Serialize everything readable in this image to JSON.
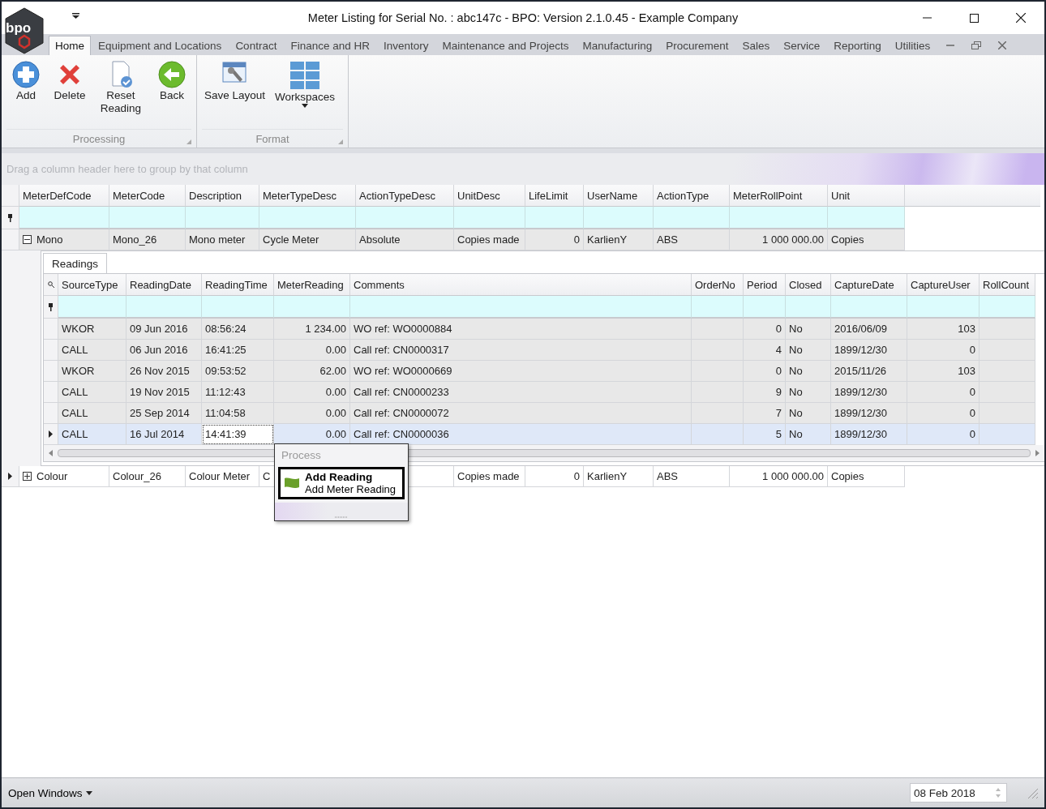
{
  "window": {
    "logo": "bpo",
    "title": "Meter Listing for Serial No. : abc147c - BPO: Version 2.1.0.45 - Example Company"
  },
  "ribbon_tabs": [
    {
      "label": "Home",
      "selected": true
    },
    {
      "label": "Equipment and Locations",
      "selected": false
    },
    {
      "label": "Contract",
      "selected": false
    },
    {
      "label": "Finance and HR",
      "selected": false
    },
    {
      "label": "Inventory",
      "selected": false
    },
    {
      "label": "Maintenance and Projects",
      "selected": false
    },
    {
      "label": "Manufacturing",
      "selected": false
    },
    {
      "label": "Procurement",
      "selected": false
    },
    {
      "label": "Sales",
      "selected": false
    },
    {
      "label": "Service",
      "selected": false
    },
    {
      "label": "Reporting",
      "selected": false
    },
    {
      "label": "Utilities",
      "selected": false
    }
  ],
  "ribbon_groups": [
    {
      "title": "Processing",
      "buttons": [
        {
          "label": "Add"
        },
        {
          "label": "Delete"
        },
        {
          "label": "Reset Reading"
        },
        {
          "label": "Back"
        }
      ]
    },
    {
      "title": "Format",
      "buttons": [
        {
          "label": "Save Layout"
        },
        {
          "label": "Workspaces",
          "dropdown": true
        }
      ]
    }
  ],
  "group_panel": {
    "hint": "Drag a column header here to group by that column"
  },
  "master_grid": {
    "columns": [
      {
        "label": "MeterDefCode"
      },
      {
        "label": "MeterCode"
      },
      {
        "label": "Description"
      },
      {
        "label": "MeterTypeDesc"
      },
      {
        "label": "ActionTypeDesc"
      },
      {
        "label": "UnitDesc"
      },
      {
        "label": "LifeLimit"
      },
      {
        "label": "UserName"
      },
      {
        "label": "ActionType"
      },
      {
        "label": "MeterRollPoint"
      },
      {
        "label": "Unit"
      }
    ],
    "rows": [
      {
        "expanded": true,
        "current": false,
        "cells": [
          "Mono",
          "Mono_26",
          "Mono meter",
          "Cycle Meter",
          "Absolute",
          "Copies made",
          "0",
          "KarlienY",
          "ABS",
          "1 000 000.00",
          "Copies"
        ]
      },
      {
        "expanded": false,
        "current": true,
        "cells": [
          "Colour",
          "Colour_26",
          "Colour Meter",
          "C",
          null,
          "Copies made",
          "0",
          "KarlienY",
          "ABS",
          "1 000 000.00",
          "Copies"
        ]
      }
    ]
  },
  "detail_tab": "Readings",
  "detail_grid": {
    "columns": [
      {
        "label": "SourceType",
        "kind": "text"
      },
      {
        "label": "ReadingDate",
        "kind": "text"
      },
      {
        "label": "ReadingTime",
        "kind": "text"
      },
      {
        "label": "MeterReading",
        "kind": "number"
      },
      {
        "label": "Comments",
        "kind": "text"
      },
      {
        "label": "OrderNo",
        "kind": "text"
      },
      {
        "label": "Period",
        "kind": "number"
      },
      {
        "label": "Closed",
        "kind": "text"
      },
      {
        "label": "CaptureDate",
        "kind": "text"
      },
      {
        "label": "CaptureUser",
        "kind": "number"
      },
      {
        "label": "RollCount",
        "kind": "text"
      }
    ],
    "rows": [
      {
        "selected": false,
        "cells": [
          "WKOR",
          "09 Jun 2016",
          "08:56:24",
          "1 234.00",
          "WO ref: WO0000884",
          null,
          "0",
          "No",
          "2016/06/09",
          "103",
          null
        ]
      },
      {
        "selected": false,
        "cells": [
          "CALL",
          "06 Jun 2016",
          "16:41:25",
          "0.00",
          "Call ref: CN0000317",
          null,
          "4",
          "No",
          "1899/12/30",
          "0",
          null
        ]
      },
      {
        "selected": false,
        "cells": [
          "WKOR",
          "26 Nov 2015",
          "09:53:52",
          "62.00",
          "WO ref: WO0000669",
          null,
          "0",
          "No",
          "2015/11/26",
          "103",
          null
        ]
      },
      {
        "selected": false,
        "cells": [
          "CALL",
          "19 Nov 2015",
          "11:12:43",
          "0.00",
          "Call ref: CN0000233",
          null,
          "9",
          "No",
          "1899/12/30",
          "0",
          null
        ]
      },
      {
        "selected": false,
        "cells": [
          "CALL",
          "25 Sep 2014",
          "11:04:58",
          "0.00",
          "Call ref: CN0000072",
          null,
          "7",
          "No",
          "1899/12/30",
          "0",
          null
        ]
      },
      {
        "selected": true,
        "cells": [
          "CALL",
          "16 Jul 2014",
          "14:41:39",
          "0.00",
          "Call ref: CN0000036",
          null,
          "5",
          "No",
          "1899/12/30",
          "0",
          null
        ]
      }
    ]
  },
  "popup": {
    "header": "Process",
    "item": {
      "title": "Add Reading",
      "subtitle": "Add Meter Reading"
    }
  },
  "status_bar": {
    "open_windows": "Open Windows",
    "date": "08 Feb 2018"
  }
}
